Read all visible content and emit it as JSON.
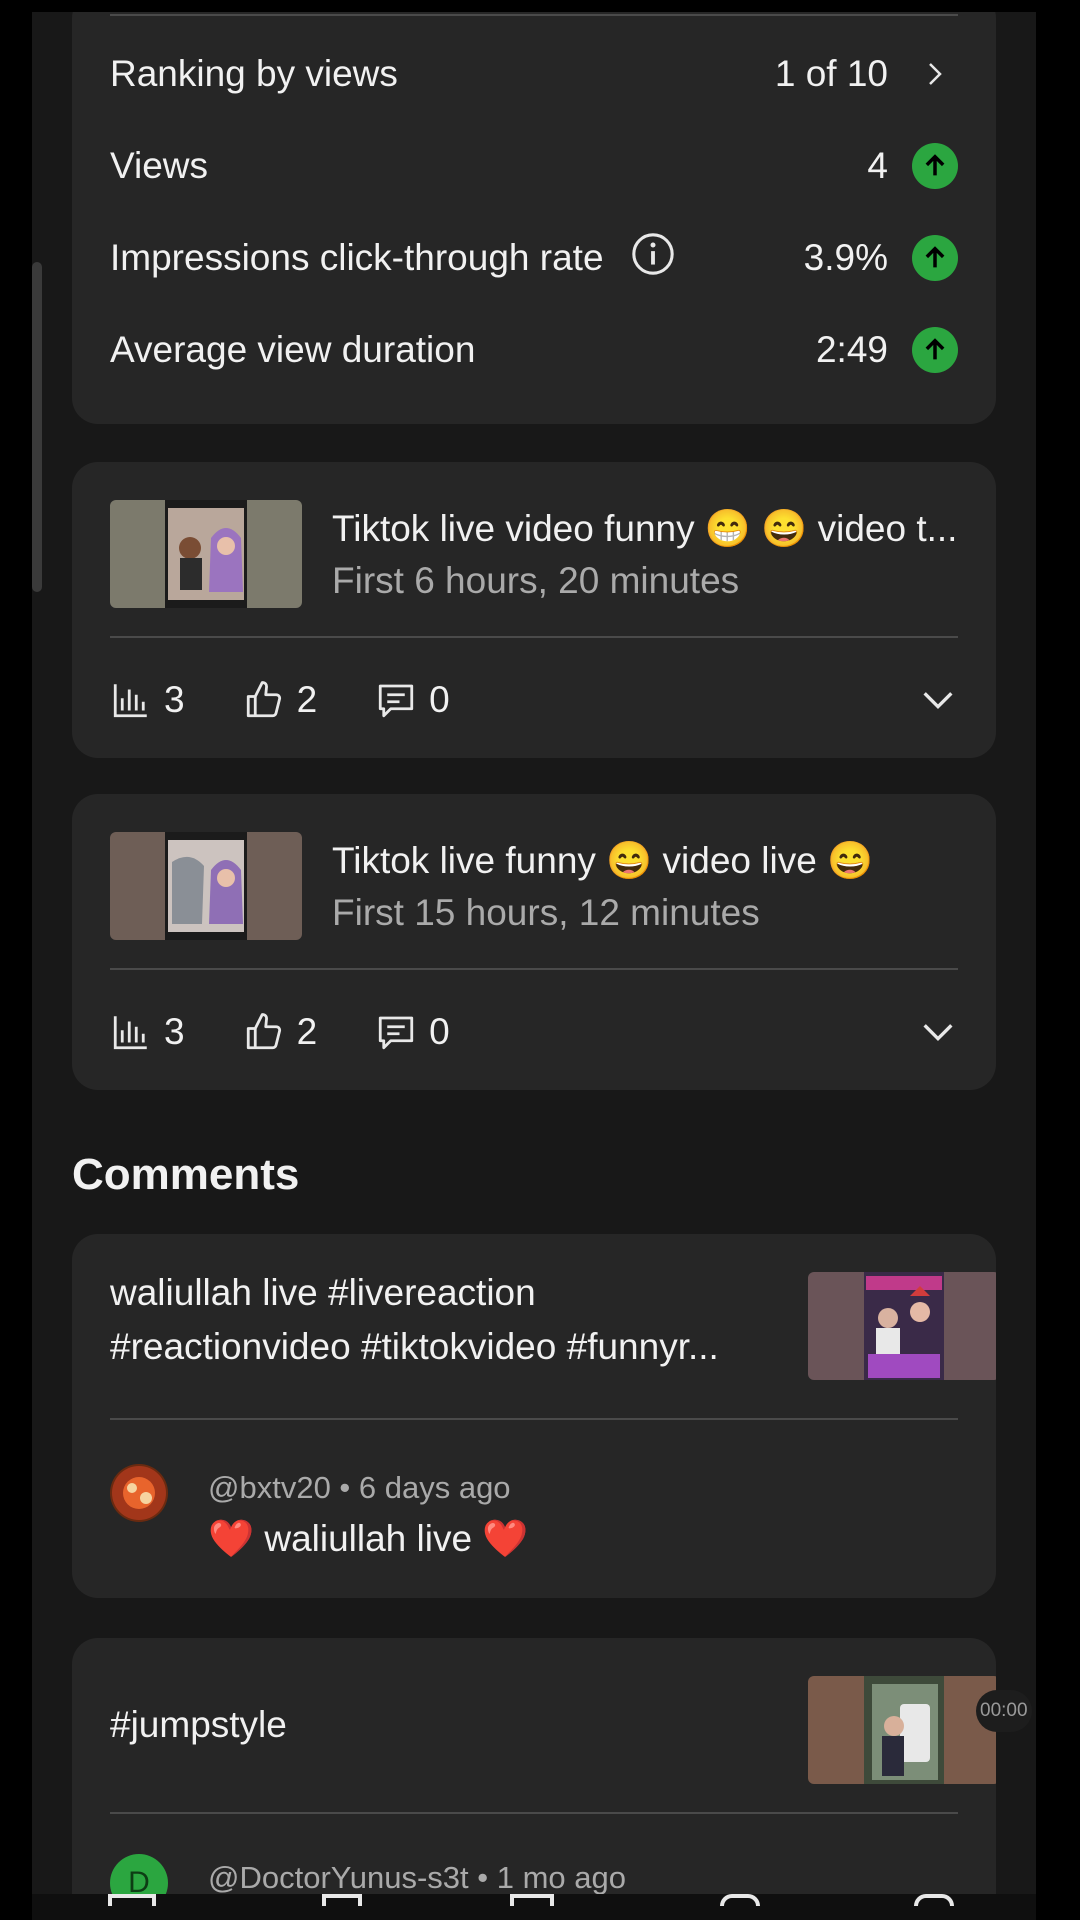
{
  "colors": {
    "background": "#181818",
    "card": "#262626",
    "accent_up": "#2ba640",
    "secondary_text": "#aaaaaa"
  },
  "metrics": {
    "ranking": {
      "label": "Ranking by views",
      "value": "1 of 10"
    },
    "views": {
      "label": "Views",
      "value": "4",
      "trend": "up"
    },
    "ctr": {
      "label": "Impressions click-through rate",
      "value": "3.9%",
      "trend": "up"
    },
    "avg_duration": {
      "label": "Average view duration",
      "value": "2:49",
      "trend": "up"
    }
  },
  "videos": [
    {
      "title": "Tiktok live video funny 😁 😄 video t...",
      "subtitle": "First 6 hours, 20 minutes",
      "views": "3",
      "likes": "2",
      "comments": "0"
    },
    {
      "title": "Tiktok live funny 😄 video live 😄",
      "subtitle": "First 15 hours, 12 minutes",
      "views": "3",
      "likes": "2",
      "comments": "0"
    }
  ],
  "comments_section": {
    "title": "Comments",
    "items": [
      {
        "video_line1": "waliullah live #livereaction",
        "video_line2": "#reactionvideo #tiktokvideo #funnyr...",
        "author": "@bxtv20",
        "age": "6 days ago",
        "meta": "@bxtv20 • 6 days ago",
        "text": "❤️ waliullah live ❤️"
      },
      {
        "video_line1": "#jumpstyle",
        "author": "@DoctorYunus-s3t",
        "age": "1 mo ago",
        "meta": "@DoctorYunus-s3t • 1 mo ago",
        "avatar_letter": "D"
      }
    ]
  },
  "overlay": {
    "timer": "00:00"
  },
  "icons": {
    "info": "info-icon",
    "arrow_up": "arrow-up-icon",
    "chevron_right": "chevron-right-icon",
    "chevron_down": "chevron-down-icon",
    "bar_chart": "bar-chart-icon",
    "thumbs_up": "thumbs-up-icon",
    "comment": "comment-icon"
  }
}
